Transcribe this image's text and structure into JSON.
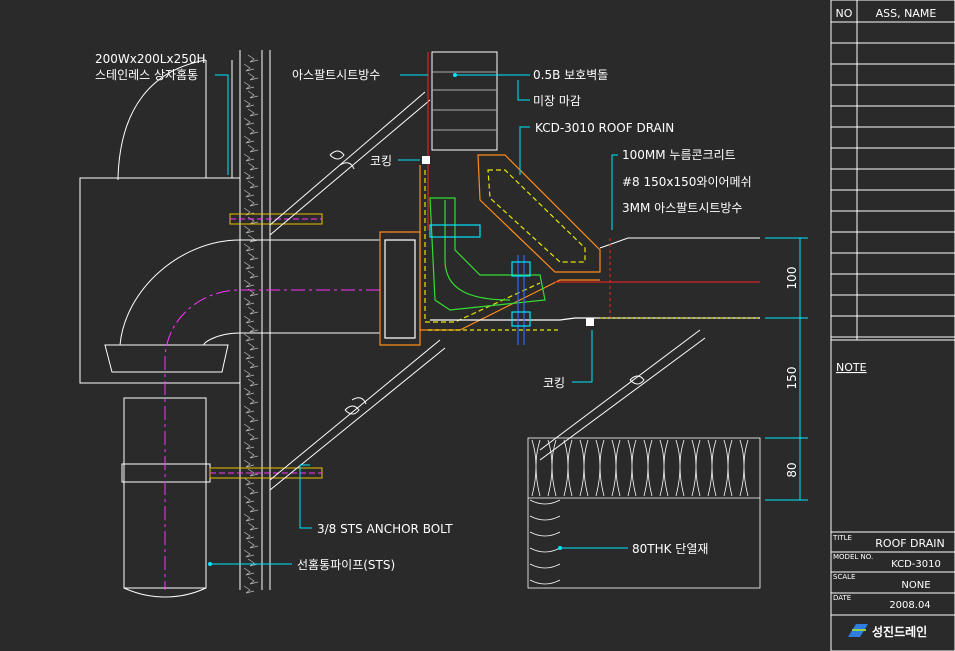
{
  "colors": {
    "background": "#2a2a2a",
    "line_white": "#ffffff",
    "leader_cyan": "#00e5ff",
    "orange": "#ff8c1a",
    "yellow": "#e6e600",
    "green": "#33dd33",
    "magenta": "#ff33ff",
    "red": "#ff2020",
    "blue": "#3366ff"
  },
  "labels": {
    "downspout_box_l1": "200Wx200Lx250H",
    "downspout_box_l2": "스테인레스 상자홈통",
    "asphalt_sheet_wall": "아스팔트시트방수",
    "brick_protect": "0.5B 보호벽돌",
    "plaster_finish": "미장 마감",
    "roof_drain": "KCD-3010 ROOF DRAIN",
    "caulking_top": "코킹",
    "concrete_100": "100MM 누름콘크리트",
    "wire_mesh": "#8 150x150와이어메쉬",
    "asphalt_3mm": "3MM 아스팔트시트방수",
    "caulking_bottom": "코킹",
    "anchor_bolt": "3/8 STS ANCHOR BOLT",
    "drain_pipe": "선홈통파이프(STS)",
    "insulation": "80THK 단열재"
  },
  "dimensions": {
    "d1": "100",
    "d2": "150",
    "d3": "80"
  },
  "title_block": {
    "col_no": "NO",
    "col_name": "ASS, NAME",
    "note": "NOTE",
    "title_label": "TITLE",
    "title_value": "ROOF DRAIN",
    "model_label": "MODEL NO.",
    "model_value": "KCD-3010",
    "scale_label": "SCALE",
    "scale_value": "NONE",
    "date_label": "DATE",
    "date_value": "2008.04",
    "company": "성진드레인"
  }
}
